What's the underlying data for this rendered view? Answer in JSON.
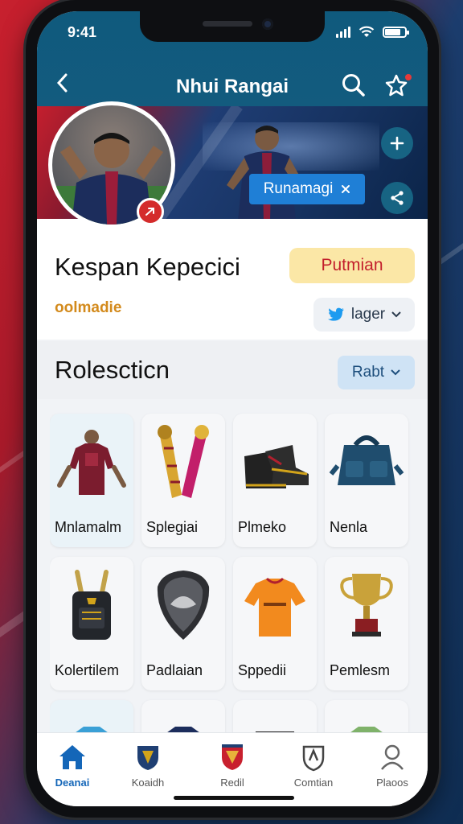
{
  "status": {
    "time": "9:41"
  },
  "nav": {
    "title": "Nhui Rangai"
  },
  "banner": {
    "chip_label": "Runamagi",
    "chip_icon": "close-icon"
  },
  "profile": {
    "name": "Kespan Kepecici",
    "subtitle": "oolmadie",
    "primary_button": "Putmian",
    "social_button": "lager"
  },
  "section": {
    "heading": "Rolescticn",
    "sort_button": "Rabt"
  },
  "collection": [
    {
      "label": "Mnlamalm",
      "icon": "jersey-icon"
    },
    {
      "label": "Splegiai",
      "icon": "scarf-icon"
    },
    {
      "label": "Plmeko",
      "icon": "boots-icon"
    },
    {
      "label": "Nenla",
      "icon": "bag-icon"
    },
    {
      "label": "Kolertilem",
      "icon": "backpack-icon"
    },
    {
      "label": "Padlaian",
      "icon": "shield-icon"
    },
    {
      "label": "Sppedii",
      "icon": "orange-jersey-icon"
    },
    {
      "label": "Pemlesm",
      "icon": "trophy-icon"
    }
  ],
  "tabs": [
    {
      "label": "Deanai",
      "icon": "home-icon",
      "active": true
    },
    {
      "label": "Koaidh",
      "icon": "crest-icon",
      "active": false
    },
    {
      "label": "Redil",
      "icon": "red-crest-icon",
      "active": false
    },
    {
      "label": "Comtian",
      "icon": "badge-icon",
      "active": false
    },
    {
      "label": "Plaoos",
      "icon": "profile-icon",
      "active": false
    }
  ],
  "colors": {
    "header": "#135b7e",
    "accent_blue": "#1466b8",
    "brand_red": "#c8202e",
    "pill_yellow": "#fbe7a6"
  }
}
